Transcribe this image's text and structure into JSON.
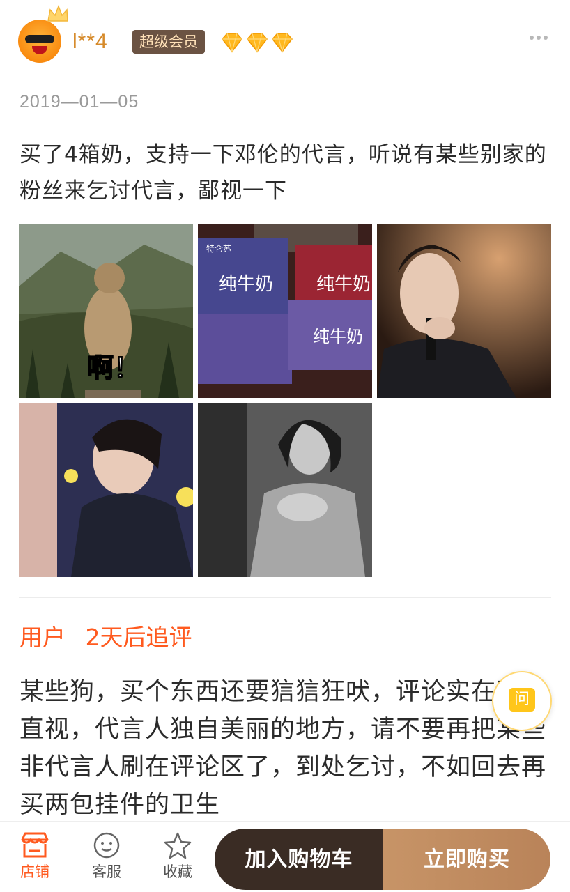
{
  "review": {
    "username": "l**4",
    "vip_label": "超级会员",
    "diamond_count": 3,
    "date": "2019—01—05",
    "text": "买了4箱奶，支持一下邓伦的代言，听说有某些别家的粉丝来乞讨代言，鄙视一下",
    "photos": [
      {
        "caption": "啊！"
      },
      {
        "box_text_1": "纯牛奶",
        "box_text_2": "纯牛奶",
        "box_text_3": "纯牛奶",
        "brand": "特仑苏"
      },
      {},
      {},
      {}
    ]
  },
  "followup": {
    "who": "用户",
    "when": "2天后追评",
    "text": "某些狗，买个东西还要狺狺狂吠，评论实在不忍直视，代言人独自美丽的地方，请不要再把某些非代言人刷在评论区了，到处乞讨，不如回去再买两包挂件的卫生"
  },
  "ask_bubble": {
    "label": "问"
  },
  "bottom_bar": {
    "shop_label": "店铺",
    "service_label": "客服",
    "favorite_label": "收藏",
    "add_to_cart": "加入购物车",
    "buy_now": "立即购买"
  },
  "colors": {
    "accent": "#ff5a1f",
    "cart_button": "#3a2c24",
    "buy_button": "#c79467",
    "vip_badge": "#6b5343"
  }
}
